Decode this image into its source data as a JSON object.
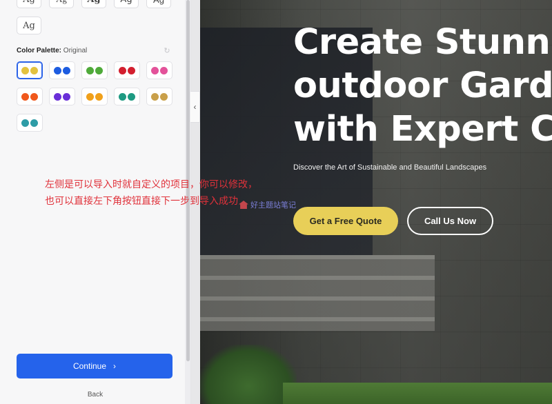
{
  "sidebar": {
    "font_tiles": [
      "Ag",
      "Ag",
      "Ag",
      "Ag",
      "Ag",
      "Ag"
    ],
    "palette_label": "Color Palette:",
    "palette_value": "Original",
    "palettes": [
      {
        "colors": [
          "#e3c23f",
          "#e3c23f"
        ],
        "selected": true
      },
      {
        "colors": [
          "#1d5ce0",
          "#1d5ce0"
        ]
      },
      {
        "colors": [
          "#4faa3a",
          "#4faa3a"
        ]
      },
      {
        "colors": [
          "#d31f2f",
          "#d31f2f"
        ]
      },
      {
        "colors": [
          "#e3529a",
          "#e3529a"
        ]
      },
      {
        "colors": [
          "#f0581c",
          "#f0581c"
        ]
      },
      {
        "colors": [
          "#6a2fd8",
          "#6a2fd8"
        ]
      },
      {
        "colors": [
          "#f0a01b",
          "#f0a01b"
        ]
      },
      {
        "colors": [
          "#1e9a82",
          "#1e9a82"
        ]
      },
      {
        "colors": [
          "#c9a04a",
          "#c9a04a"
        ]
      },
      {
        "colors": [
          "#2e9ca6",
          "#2e9ca6"
        ]
      }
    ],
    "continue_label": "Continue",
    "back_label": "Back"
  },
  "preview": {
    "hero_lines": [
      "Create Stunnin",
      "outdoor Garde",
      "with Expert Ca"
    ],
    "subtitle": "Discover the Art of Sustainable and Beautiful Landscapes",
    "primary_cta": "Get a Free Quote",
    "secondary_cta": "Call Us Now"
  },
  "annotation": {
    "line1": "左侧是可以导入时就自定义的项目，你可以修改，",
    "line2": "也可以直接左下角按钮直接下一步到导入成功",
    "watermark": "好主题站笔记"
  },
  "colors": {
    "accent": "#2563eb",
    "cta_yellow": "#e8cf58",
    "annotation_red": "#e0313a"
  }
}
